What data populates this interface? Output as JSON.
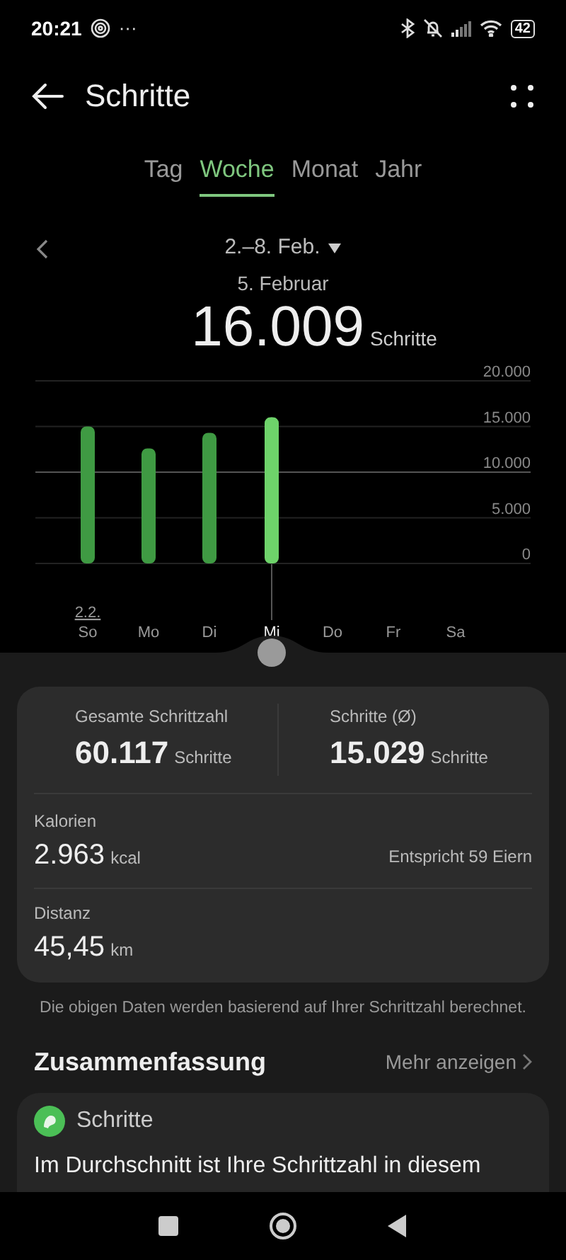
{
  "status_bar": {
    "time": "20:21",
    "overflow": "···",
    "battery": "42"
  },
  "header": {
    "title": "Schritte"
  },
  "tabs": [
    {
      "label": "Tag",
      "selected": false
    },
    {
      "label": "Woche",
      "selected": true
    },
    {
      "label": "Monat",
      "selected": false
    },
    {
      "label": "Jahr",
      "selected": false
    }
  ],
  "period": {
    "range": "2.–8. Feb.",
    "selected_date": "5. Februar",
    "value": "16.009",
    "unit": "Schritte"
  },
  "chart": {
    "week_start_label": "2.2.",
    "bars": [
      {
        "selected": false
      },
      {
        "selected": false
      },
      {
        "selected": false
      },
      {
        "selected": true
      },
      {
        "selected": false
      },
      {
        "selected": false
      },
      {
        "selected": false
      }
    ],
    "chart_data": {
      "type": "bar",
      "categories": [
        "So",
        "Mo",
        "Di",
        "Mi",
        "Do",
        "Fr",
        "Sa"
      ],
      "values": [
        15000,
        12600,
        14300,
        16000,
        null,
        null,
        null
      ],
      "grid": true,
      "ylim": [
        0,
        20000
      ],
      "yticks": [
        {
          "value": 0,
          "label": "0"
        },
        {
          "value": 5000,
          "label": "5.000"
        },
        {
          "value": 10000,
          "label": "10.000"
        },
        {
          "value": 15000,
          "label": "15.000"
        },
        {
          "value": 20000,
          "label": "20.000"
        }
      ]
    }
  },
  "summary_card": {
    "total": {
      "label": "Gesamte Schrittzahl",
      "value": "60.117",
      "unit": "Schritte"
    },
    "average": {
      "label": "Schritte (Ø)",
      "value": "15.029",
      "unit": "Schritte"
    },
    "calories": {
      "label": "Kalorien",
      "value": "2.963",
      "unit": "kcal",
      "note": "Entspricht 59 Eiern"
    },
    "distance": {
      "label": "Distanz",
      "value": "45,45",
      "unit": "km"
    }
  },
  "footnote": "Die obigen Daten werden basierend auf Ihrer Schrittzahl berechnet.",
  "overview": {
    "title": "Zusammenfassung",
    "more_link": "Mehr anzeigen",
    "card_title": "Schritte",
    "card_text": "Im Durchschnitt ist Ihre Schrittzahl in diesem"
  }
}
